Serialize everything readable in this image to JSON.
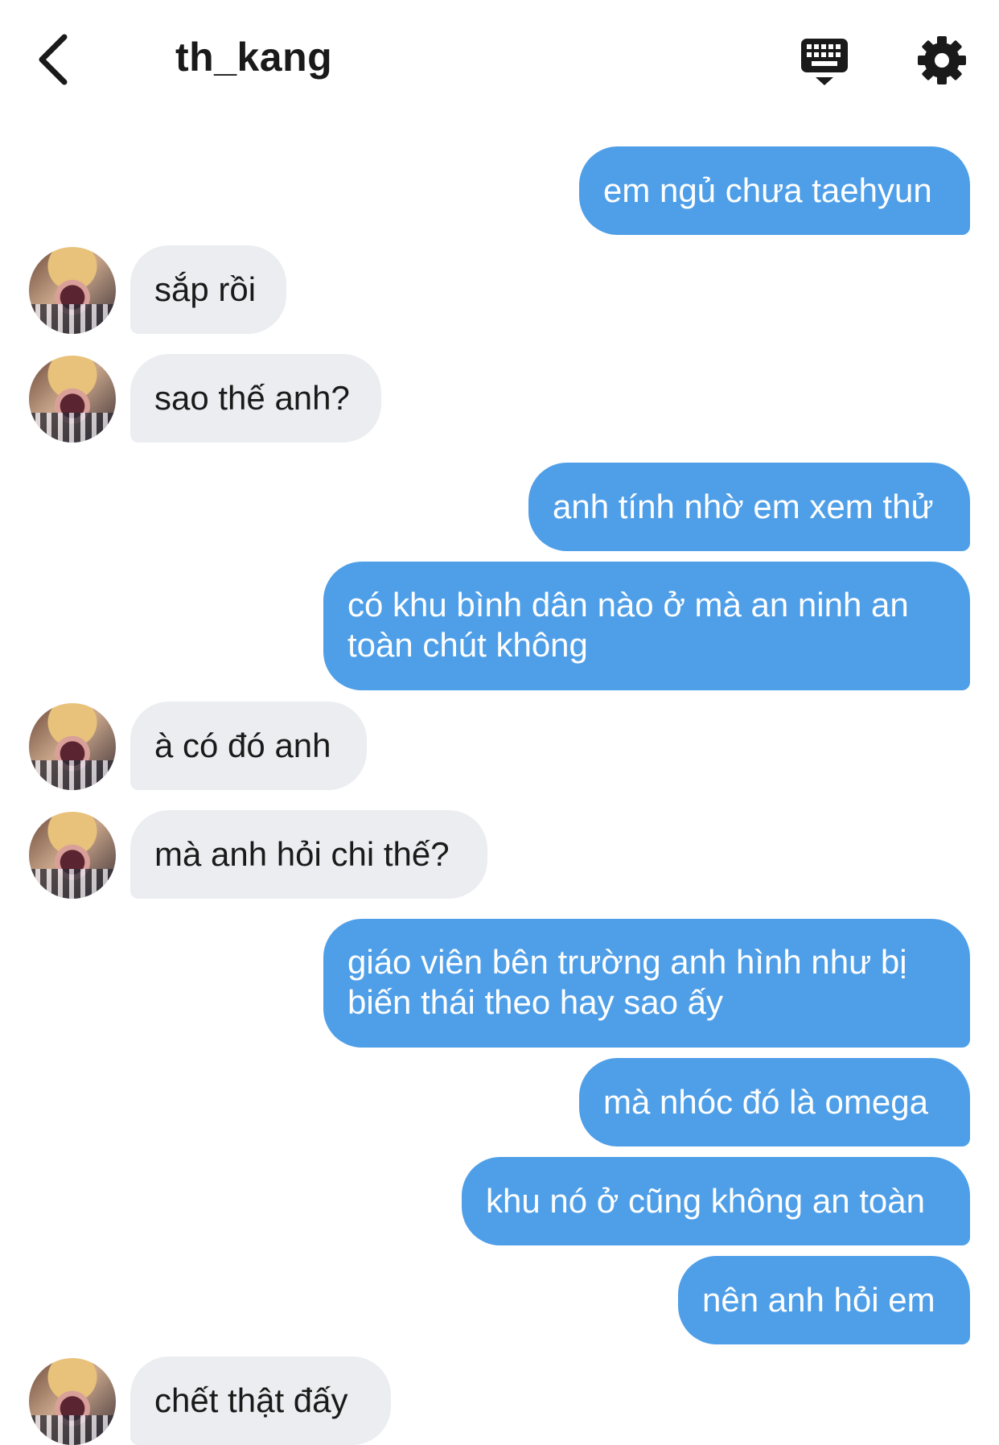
{
  "header": {
    "title": "th_kang",
    "back_icon": "chevron-left-icon",
    "keyboard_icon": "keyboard-icon",
    "settings_icon": "gear-icon"
  },
  "colors": {
    "outgoing_bubble": "#4f9fe8",
    "incoming_bubble": "#ebedf0",
    "text_dark": "#1a1a1a"
  },
  "messages": [
    {
      "dir": "out",
      "text": "em ngủ chưa taehyun"
    },
    {
      "dir": "in",
      "text": "sắp rồi"
    },
    {
      "dir": "in",
      "text": "sao thế anh?"
    },
    {
      "dir": "out",
      "text": "anh tính nhờ em xem thử"
    },
    {
      "dir": "out",
      "text": "có khu bình dân nào ở mà an ninh an toàn chút không"
    },
    {
      "dir": "in",
      "text": "à có đó anh"
    },
    {
      "dir": "in",
      "text": "mà anh hỏi chi thế?"
    },
    {
      "dir": "out",
      "text": "giáo viên bên trường anh hình như bị biến thái theo hay sao ấy"
    },
    {
      "dir": "out",
      "text": "mà nhóc đó là omega"
    },
    {
      "dir": "out",
      "text": "khu nó ở cũng không an toàn"
    },
    {
      "dir": "out",
      "text": "nên anh hỏi em"
    },
    {
      "dir": "in",
      "text": "chết thật đấy"
    }
  ]
}
